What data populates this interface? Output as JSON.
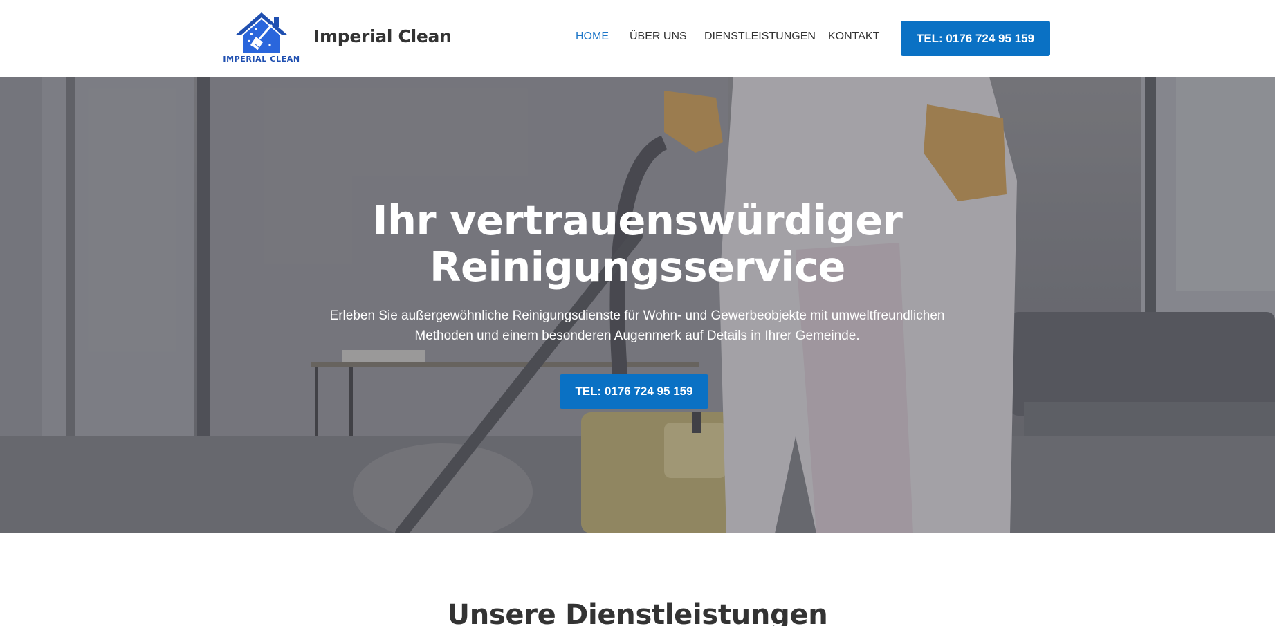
{
  "brand": {
    "logo_text": "IMPERIAL CLEAN",
    "name": "Imperial Clean",
    "logo_color": "#2a5fd0"
  },
  "nav": {
    "items": [
      {
        "label": "HOME",
        "active": true
      },
      {
        "label": "ÜBER UNS",
        "active": false
      },
      {
        "label": "DIENSTLEISTUNGEN",
        "active": false
      },
      {
        "label": "KONTAKT",
        "active": false
      }
    ],
    "cta_label": "TEL: 0176 724 95 159"
  },
  "hero": {
    "title_line1": "Ihr vertrauenswürdiger",
    "title_line2": "Reinigungsservice",
    "subtitle_line1": "Erleben Sie außergewöhnliche Reinigungsdienste für Wohn- und Gewerbeobjekte mit umweltfreundlichen",
    "subtitle_line2": "Methoden und einem besonderen Augenmerk auf Details in Ihrer Gemeinde.",
    "cta_label": "TEL: 0176 724 95 159"
  },
  "services": {
    "title": "Unsere Dienstleistungen"
  },
  "colors": {
    "accent": "#0a71c4",
    "nav_active": "#1d76c8",
    "text_dark": "#333333"
  }
}
